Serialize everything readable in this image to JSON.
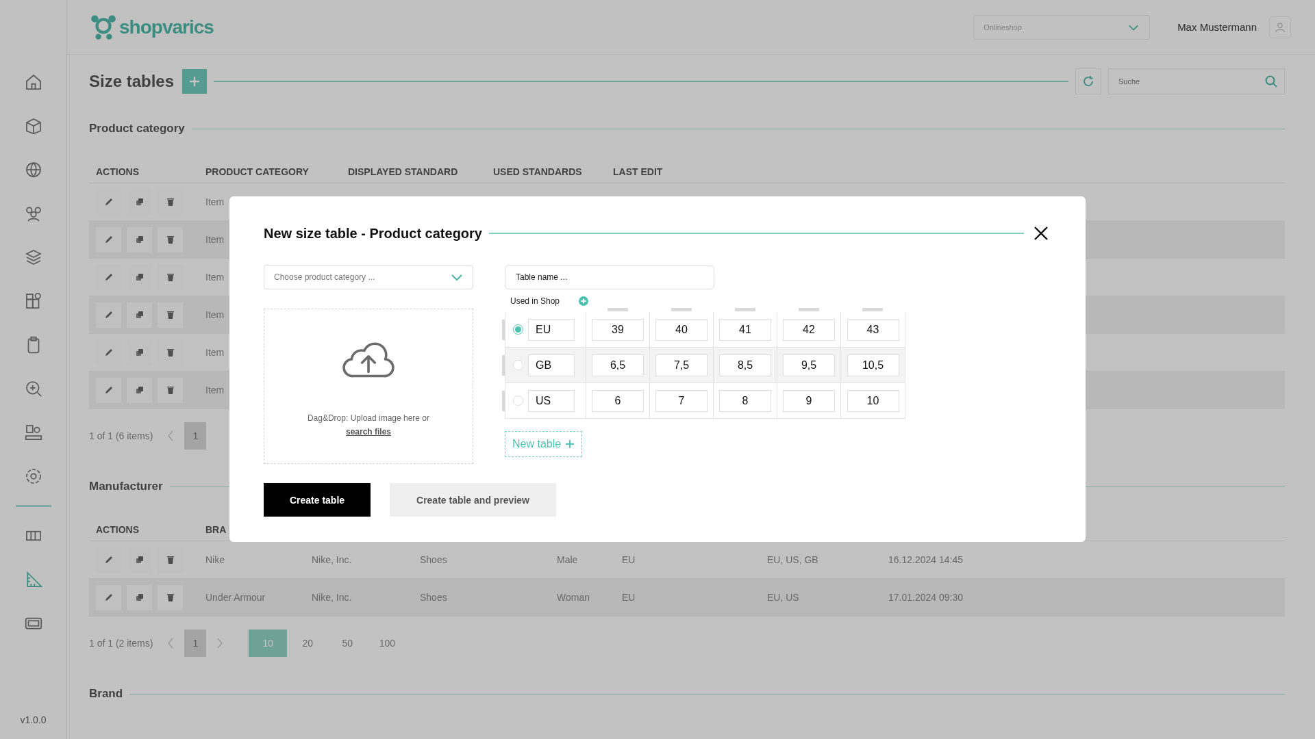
{
  "app": {
    "logo_text": "shopvarics",
    "shop_selector": "Onlineshop",
    "user_name": "Max Mustermann",
    "version": "v1.0.0"
  },
  "sidebar": {
    "items": [
      {
        "selected": false
      },
      {
        "selected": false
      },
      {
        "selected": false
      },
      {
        "selected": false
      },
      {
        "selected": false
      },
      {
        "selected": false
      },
      {
        "selected": false
      },
      {
        "selected": false
      },
      {
        "selected": false
      },
      {
        "selected": false
      },
      {
        "selected": false
      },
      {
        "selected": true
      },
      {
        "selected": false
      }
    ]
  },
  "page": {
    "title": "Size tables",
    "search_placeholder": "Suche"
  },
  "sections": [
    {
      "title": "Product category",
      "actions_header": "ACTIONS",
      "columns": [
        "PRODUCT CATEGORY",
        "DISPLAYED STANDARD",
        "USED STANDARDS",
        "LAST EDIT"
      ],
      "rows": [
        {
          "cells": [
            "Item"
          ]
        },
        {
          "cells": [
            "Item"
          ]
        },
        {
          "cells": [
            "Item"
          ]
        },
        {
          "cells": [
            "Item"
          ]
        },
        {
          "cells": [
            "Item"
          ]
        },
        {
          "cells": [
            "Item"
          ]
        }
      ],
      "pagination": {
        "summary": "1 of 1 (6 items)",
        "pages": [
          {
            "label": "1",
            "selected": true
          }
        ]
      }
    },
    {
      "title": "Manufacturer",
      "actions_header": "ACTIONS",
      "columns": [
        "BRA"
      ],
      "rows": [
        {
          "cells": [
            "Nike",
            "Nike, Inc.",
            "Shoes",
            "Male",
            "EU",
            "EU, US, GB",
            "16.12.2024 14:45"
          ]
        },
        {
          "cells": [
            "Under Armour",
            "Nike, Inc.",
            "Shoes",
            "Woman",
            "EU",
            "EU, US",
            "17.01.2024 09:30"
          ]
        }
      ],
      "pagination": {
        "summary": "1 of 1 (2 items)",
        "pages": [
          {
            "label": "1",
            "selected": true
          }
        ],
        "page_sizes": [
          {
            "label": "10",
            "selected": true
          },
          {
            "label": "20",
            "selected": false
          },
          {
            "label": "50",
            "selected": false
          },
          {
            "label": "100",
            "selected": false
          }
        ]
      }
    },
    {
      "title": "Brand"
    }
  ],
  "dialog": {
    "title": "New size table - Product category",
    "category_placeholder": "Choose product category ...",
    "upload_text": "Dag&Drop: Upload image here or",
    "upload_link": "search files",
    "table_name_placeholder": "Table name ...",
    "used_in_shop_label": "Used in Shop",
    "standards": [
      {
        "name": "EU",
        "selected": true,
        "sizes": [
          "39",
          "40",
          "41",
          "42",
          "43"
        ]
      },
      {
        "name": "GB",
        "selected": false,
        "sizes": [
          "6,5",
          "7,5",
          "8,5",
          "9,5",
          "10,5"
        ]
      },
      {
        "name": "US",
        "selected": false,
        "sizes": [
          "6",
          "7",
          "8",
          "9",
          "10"
        ]
      }
    ],
    "new_table_button": "New table",
    "buttons": [
      {
        "label": "Create table",
        "kind": "primary"
      },
      {
        "label": "Create table and preview",
        "kind": "secondary"
      }
    ]
  }
}
